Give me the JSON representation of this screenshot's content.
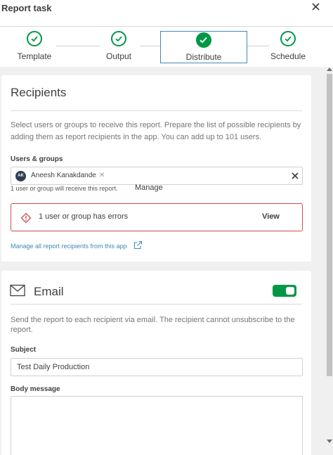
{
  "header": {
    "title": "Report task"
  },
  "steps": [
    {
      "label": "Template"
    },
    {
      "label": "Output"
    },
    {
      "label": "Distribute"
    },
    {
      "label": "Schedule"
    }
  ],
  "recipients": {
    "title": "Recipients",
    "description": "Select users or groups to receive this report. Prepare the list of possible recipients by adding them as report recipients in the app. You can add up to 101 users.",
    "users_label": "Users & groups",
    "chip": {
      "initials": "AK",
      "name": "Aneesh Kanakdande"
    },
    "count_text": "1 user or group will receive this report.",
    "manage_label": "Manage",
    "error_text": "1 user or group has errors",
    "view_label": "View",
    "manage_all_link": "Manage all report recipients from this app"
  },
  "email": {
    "title": "Email",
    "enabled": true,
    "description": "Send the report to each recipient via email. The recipient cannot unsubscribe to the report.",
    "subject_label": "Subject",
    "subject_value": "Test Daily Production",
    "body_label": "Body message",
    "body_value": ""
  },
  "colors": {
    "success": "#009845",
    "error": "#d24b4b",
    "link": "#3f8ab3",
    "active_step_border": "#3f8ab3"
  }
}
